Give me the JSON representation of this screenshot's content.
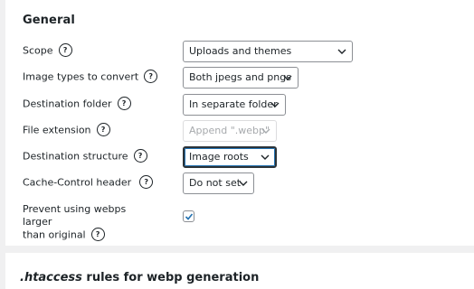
{
  "section": {
    "title": "General"
  },
  "fields": {
    "scope": {
      "label": "Scope",
      "help": "?",
      "value": "Uploads and themes"
    },
    "image_types": {
      "label": "Image types to convert",
      "help": "?",
      "value": "Both jpegs and pngs"
    },
    "destination_folder": {
      "label": "Destination folder",
      "help": "?",
      "value": "In separate folder"
    },
    "file_extension": {
      "label": "File extension",
      "help": "?",
      "value": "Append \".webp\""
    },
    "destination_structure": {
      "label": "Destination structure",
      "help": "?",
      "value": "Image roots"
    },
    "cache_control": {
      "label": "Cache-Control header",
      "help": "?",
      "value": "Do not set"
    },
    "prevent_larger": {
      "label_line1": "Prevent using webps larger",
      "label_line2": "than original",
      "help": "?",
      "checked": true
    }
  },
  "next_section": {
    "title_em": ".htaccess",
    "title_rest": " rules for webp generation"
  },
  "colors": {
    "background": "#f0f0f1",
    "panel": "#ffffff",
    "text": "#1d2327",
    "accent": "#2271b1",
    "disabled_text": "#a7aaad"
  },
  "icons": {
    "help": "question-circle-icon",
    "dropdown": "chevron-down-icon",
    "check": "checkmark-icon"
  }
}
